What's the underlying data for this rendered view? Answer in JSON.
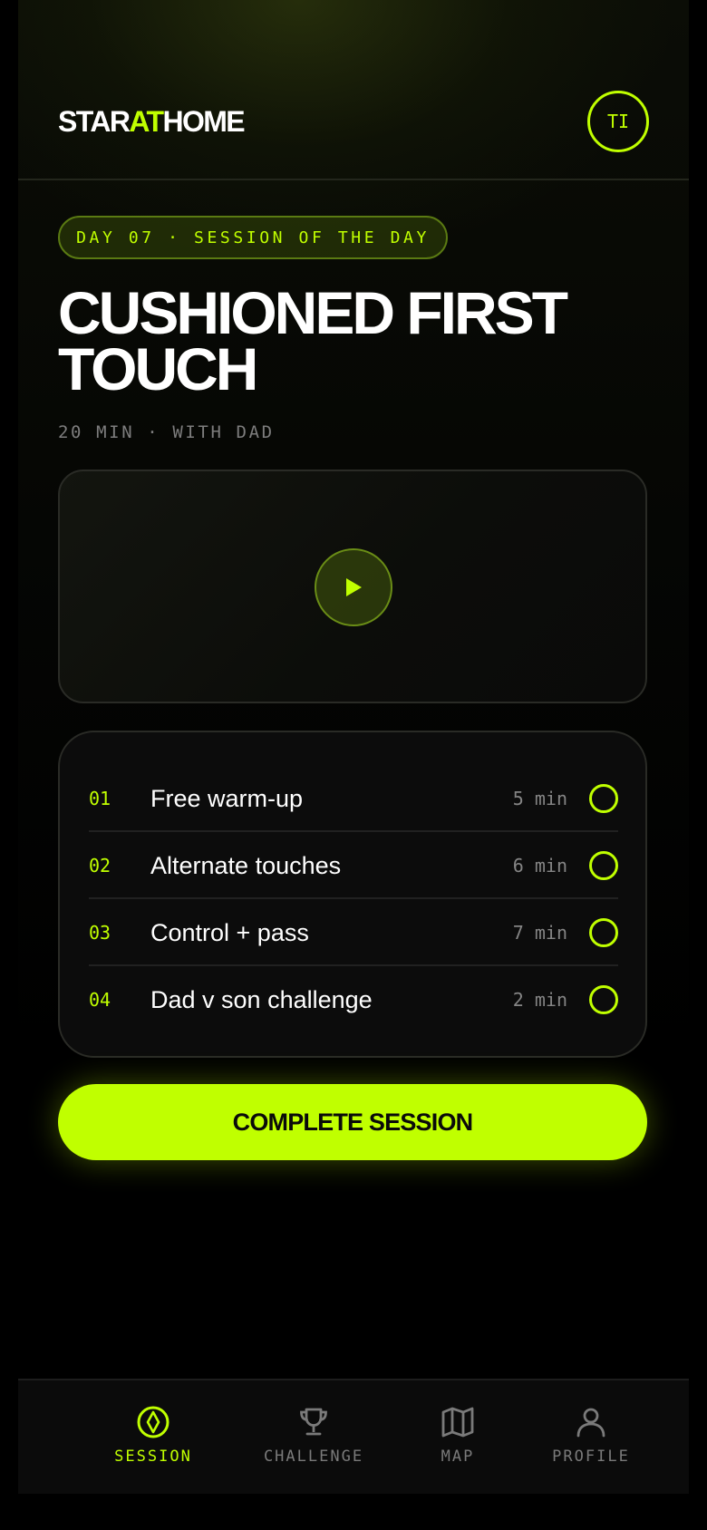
{
  "brand": {
    "logo_part1": "STAR",
    "logo_part2": "AT",
    "logo_part3": "HOME"
  },
  "user": {
    "initials": "TI"
  },
  "session": {
    "day_label": "DAY 07 · SESSION OF THE DAY",
    "title": "CUSHIONED FIRST TOUCH",
    "meta": "20 MIN · WITH DAD",
    "video_icon": "play-icon"
  },
  "drills": [
    {
      "number": "01",
      "name": "Free warm-up",
      "duration": "5 min",
      "completed": false
    },
    {
      "number": "02",
      "name": "Alternate touches",
      "duration": "6 min",
      "completed": false
    },
    {
      "number": "03",
      "name": "Control + pass",
      "duration": "7 min",
      "completed": false
    },
    {
      "number": "04",
      "name": "Dad v son challenge",
      "duration": "2 min",
      "completed": false
    }
  ],
  "cta": {
    "label": "COMPLETE SESSION"
  },
  "nav": {
    "active": "session",
    "tabs": [
      {
        "id": "session",
        "label": "SESSION",
        "icon": "compass-icon"
      },
      {
        "id": "challenge",
        "label": "CHALLENGE",
        "icon": "trophy-icon"
      },
      {
        "id": "map",
        "label": "MAP",
        "icon": "map-icon"
      },
      {
        "id": "profile",
        "label": "PROFILE",
        "icon": "person-icon"
      }
    ]
  },
  "colors": {
    "accent": "#c0ff00",
    "background": "#000000",
    "card": "#0c0c0c",
    "muted": "#7a7a7a"
  }
}
